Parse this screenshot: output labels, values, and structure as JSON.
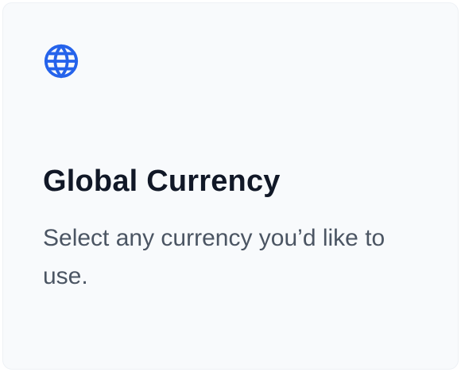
{
  "card": {
    "icon": "globe-icon",
    "accent_color": "#2563eb",
    "title": "Global Currency",
    "description": "Select any currency you’d like to use."
  }
}
